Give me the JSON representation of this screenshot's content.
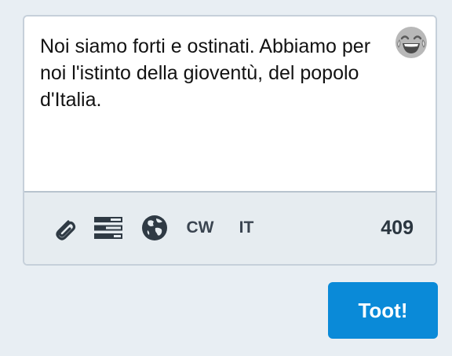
{
  "compose": {
    "text": "Noi siamo forti e ostinati. Abbiamo per noi l'istinto della gioventù, del popolo d'Italia.",
    "emoji_icon": "laughing-tears-emoji-icon"
  },
  "toolbar": {
    "attach_icon": "paperclip-icon",
    "poll_icon": "poll-icon",
    "privacy_icon": "globe-icon",
    "cw_label": "CW",
    "language_label": "IT",
    "char_count": "409"
  },
  "actions": {
    "submit_label": "Toot!"
  },
  "colors": {
    "background": "#e8eef3",
    "toolbar_bg": "#e6ecf0",
    "border": "#c6d0da",
    "accent": "#0a8ad8",
    "text": "#121212",
    "icon": "#2f3a44"
  }
}
